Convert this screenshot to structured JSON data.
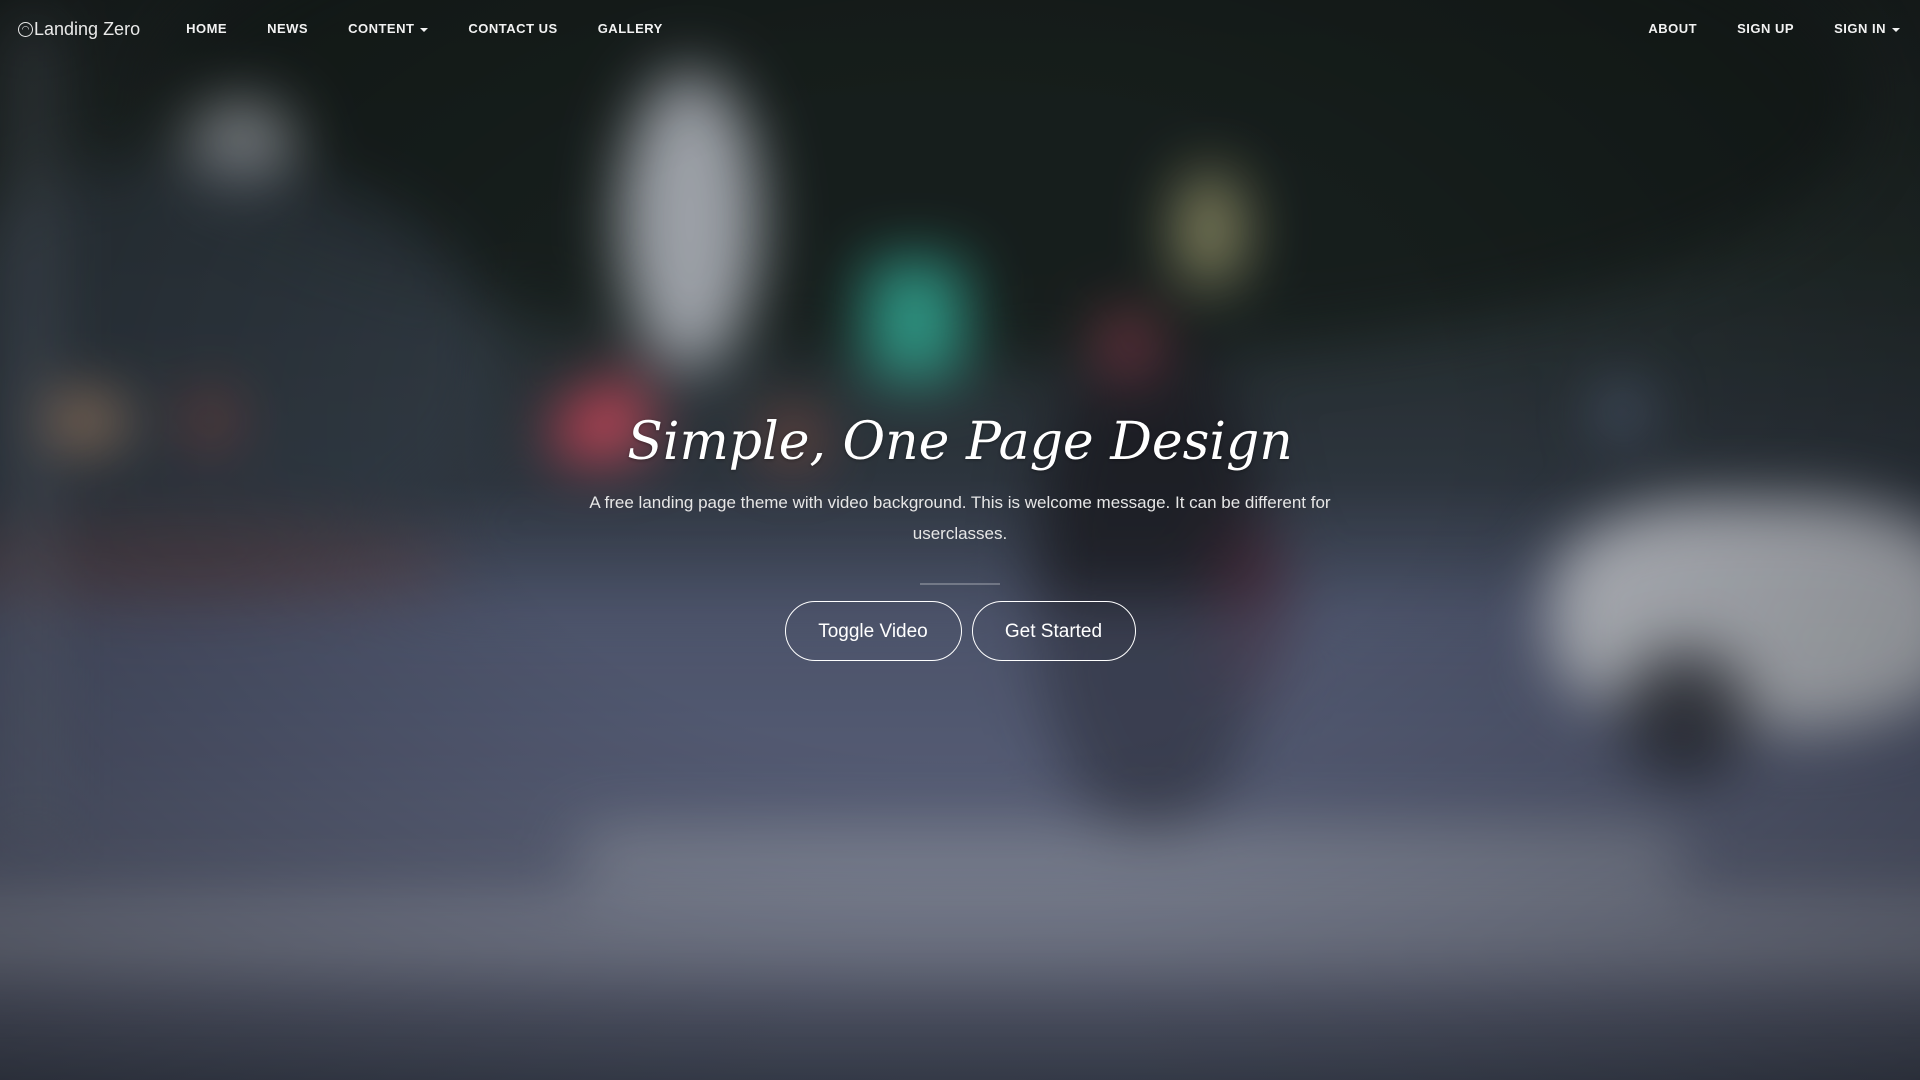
{
  "brand": {
    "name": "Landing Zero",
    "icon": "circle-logo-icon"
  },
  "nav": {
    "left": [
      {
        "label": "HOME"
      },
      {
        "label": "NEWS"
      },
      {
        "label": "CONTENT",
        "dropdown": true
      },
      {
        "label": "CONTACT US"
      },
      {
        "label": "GALLERY"
      }
    ],
    "right": [
      {
        "label": "ABOUT"
      },
      {
        "label": "SIGN UP"
      },
      {
        "label": "SIGN IN",
        "dropdown": true
      }
    ]
  },
  "hero": {
    "title": "Simple, One Page Design",
    "subtitle": "A free landing page theme with video background.  This is welcome message. It can be different for userclasses.",
    "buttons": {
      "toggle_video": "Toggle Video",
      "get_started": "Get Started"
    }
  },
  "colors": {
    "text": "#ffffff",
    "nav_text": "#f2f2f2",
    "button_border": "#ffffff"
  }
}
